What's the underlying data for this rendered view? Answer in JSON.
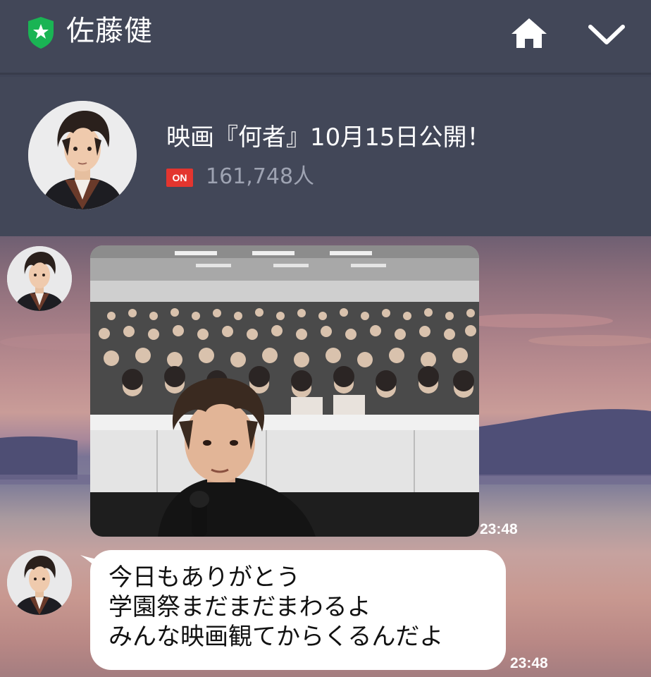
{
  "header": {
    "account_name": "佐藤健",
    "official_icon": "star-shield-icon",
    "home_icon": "home-icon",
    "collapse_icon": "chevron-down-icon"
  },
  "account": {
    "status_message": "映画『何者』10月15日公開！",
    "on_badge": "ON",
    "followers": "161,748人",
    "avatar_icon": "profile-photo"
  },
  "messages": [
    {
      "type": "image",
      "description_icon": "photo-selfie-lecture-hall",
      "time": "23:48"
    },
    {
      "type": "text",
      "lines": [
        "今日もありがとう",
        "学園祭まだまだまわるよ",
        "みんな映画観てからくるんだよ"
      ],
      "time": "23:48"
    }
  ],
  "colors": {
    "header_bg": "#424758",
    "on_badge": "#e3352f",
    "shield_green": "#1ab454"
  }
}
